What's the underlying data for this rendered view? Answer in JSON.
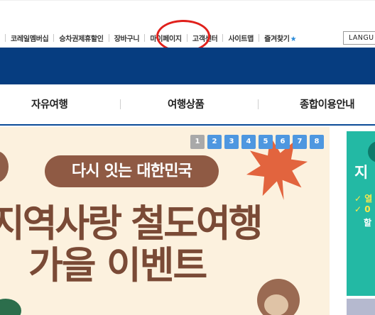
{
  "utility_nav": {
    "items": [
      {
        "label": "코레일멤버십"
      },
      {
        "label": "승차권제휴할인"
      },
      {
        "label": "장바구니"
      },
      {
        "label": "마이페이지"
      },
      {
        "label": "고객센터"
      },
      {
        "label": "사이트맵"
      },
      {
        "label": "즐겨찾기"
      }
    ],
    "language_button": "LANGU"
  },
  "main_nav": {
    "items": [
      {
        "label": "자유여행"
      },
      {
        "label": "여행상품"
      },
      {
        "label": "종합이용안내"
      }
    ]
  },
  "event_banner": {
    "pager": [
      "1",
      "2",
      "3",
      "4",
      "5",
      "6",
      "7",
      "8"
    ],
    "active_page": "1",
    "pill_text": "다시 잇는 대한민국",
    "headline_line1": "지역사랑 철도여행",
    "headline_line2": "가을 이벤트"
  },
  "side_banner": {
    "title": "지",
    "lines": [
      "✓ 열",
      "✓ 0",
      "할"
    ]
  },
  "colors": {
    "header_blue": "#063d80",
    "highlight_red": "#e0201b",
    "pager_blue": "#4e97e0",
    "banner_bg": "#fcf1de",
    "headline_brown": "#7a4a36",
    "side_teal": "#23b9a4"
  },
  "icons": {
    "favorites": "star-icon",
    "decoration": "maple-leaf-icon"
  }
}
